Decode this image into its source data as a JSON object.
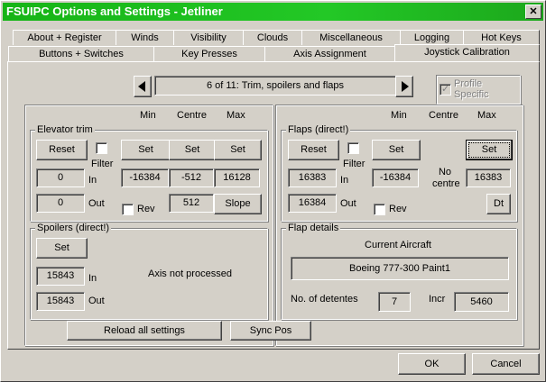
{
  "window": {
    "title": "FSUIPC Options and Settings - Jetliner",
    "close": "✕"
  },
  "tabs_row1": [
    "About + Register",
    "Winds",
    "Visibility",
    "Clouds",
    "Miscellaneous",
    "Logging",
    "Hot Keys"
  ],
  "tabs_row2": [
    "Buttons + Switches",
    "Key Presses",
    "Axis Assignment",
    "Joystick Calibration"
  ],
  "nav": {
    "page": "6 of 11: Trim, spoilers and flaps",
    "profile": "Profile Specific"
  },
  "headers": {
    "min": "Min",
    "centre": "Centre",
    "max": "Max"
  },
  "elevator": {
    "title": "Elevator trim",
    "reset": "Reset",
    "filter": "Filter",
    "set_min": "Set",
    "set_centre": "Set",
    "set_max": "Set",
    "in_val": "0",
    "in_label": "In",
    "out_val": "0",
    "out_label": "Out",
    "min": "-16384",
    "centre": "-512",
    "max": "16128",
    "rev": "Rev",
    "centre2": "512",
    "slope": "Slope"
  },
  "spoilers": {
    "title": "Spoilers (direct!)",
    "set": "Set",
    "in_val": "15843",
    "in_label": "In",
    "out_val": "15843",
    "out_label": "Out",
    "status": "Axis not processed"
  },
  "flaps": {
    "title": "Flaps (direct!)",
    "reset": "Reset",
    "filter": "Filter",
    "set_min": "Set",
    "set_max": "Set",
    "in_val": "16383",
    "in_label": "In",
    "out_val": "16384",
    "out_label": "Out",
    "min": "-16384",
    "no_centre": "No centre",
    "max": "16383",
    "rev": "Rev",
    "dt": "Dt"
  },
  "flap_details": {
    "title": "Flap details",
    "current_label": "Current Aircraft",
    "aircraft": "Boeing 777-300 Paint1",
    "detentes_label": "No. of detentes",
    "detentes": "7",
    "incr_label": "Incr",
    "incr": "5460"
  },
  "buttons": {
    "reload": "Reload all settings",
    "sync": "Sync Pos",
    "ok": "OK",
    "cancel": "Cancel"
  }
}
